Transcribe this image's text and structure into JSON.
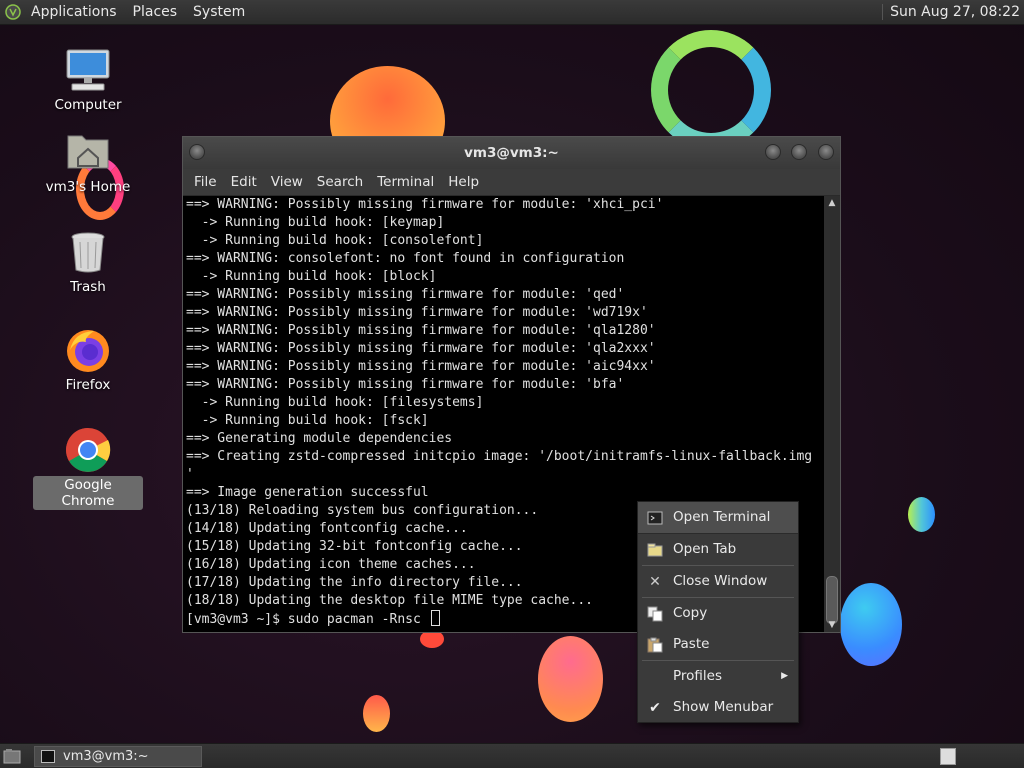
{
  "top_panel": {
    "menus": [
      "Applications",
      "Places",
      "System"
    ],
    "clock": "Sun Aug 27, 08:22"
  },
  "desktop_icons": [
    {
      "label": "Computer"
    },
    {
      "label": "vm3's Home"
    },
    {
      "label": "Trash"
    },
    {
      "label": "Firefox"
    },
    {
      "label": "Google Chrome"
    }
  ],
  "terminal": {
    "title": "vm3@vm3:~",
    "menu": [
      "File",
      "Edit",
      "View",
      "Search",
      "Terminal",
      "Help"
    ],
    "lines": [
      "==> WARNING: Possibly missing firmware for module: 'xhci_pci'",
      "  -> Running build hook: [keymap]",
      "  -> Running build hook: [consolefont]",
      "==> WARNING: consolefont: no font found in configuration",
      "  -> Running build hook: [block]",
      "==> WARNING: Possibly missing firmware for module: 'qed'",
      "==> WARNING: Possibly missing firmware for module: 'wd719x'",
      "==> WARNING: Possibly missing firmware for module: 'qla1280'",
      "==> WARNING: Possibly missing firmware for module: 'qla2xxx'",
      "==> WARNING: Possibly missing firmware for module: 'aic94xx'",
      "==> WARNING: Possibly missing firmware for module: 'bfa'",
      "  -> Running build hook: [filesystems]",
      "  -> Running build hook: [fsck]",
      "==> Generating module dependencies",
      "==> Creating zstd-compressed initcpio image: '/boot/initramfs-linux-fallback.img",
      "'",
      "==> Image generation successful",
      "(13/18) Reloading system bus configuration...",
      "(14/18) Updating fontconfig cache...",
      "(15/18) Updating 32-bit fontconfig cache...",
      "(16/18) Updating icon theme caches...",
      "(17/18) Updating the info directory file...",
      "(18/18) Updating the desktop file MIME type cache..."
    ],
    "prompt": "[vm3@vm3 ~]$ sudo pacman -Rnsc "
  },
  "context_menu": {
    "items": [
      {
        "label": "Open Terminal",
        "icon": "terminal-icon"
      },
      {
        "label": "Open Tab",
        "icon": "tab-icon"
      },
      {
        "label": "Close Window",
        "icon": "close-icon"
      },
      {
        "label": "Copy",
        "icon": "copy-icon"
      },
      {
        "label": "Paste",
        "icon": "paste-icon"
      },
      {
        "label": "Profiles",
        "icon": "submenu-arrow-icon"
      },
      {
        "label": "Show Menubar",
        "icon": "checkmark-icon"
      }
    ]
  },
  "bottom_panel": {
    "task_label": "vm3@vm3:~"
  },
  "colors": {
    "panel": "#2b2b2b",
    "terminal_bg": "#000000",
    "terminal_fg": "#e0e0e0",
    "menu_bg": "#3a3a3a"
  }
}
